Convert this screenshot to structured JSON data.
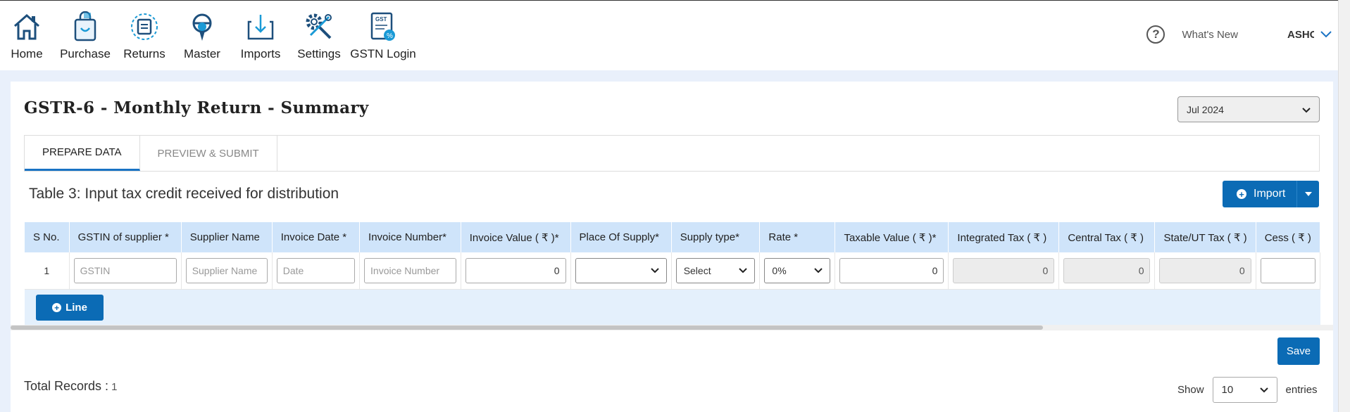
{
  "nav": {
    "items": [
      {
        "label": "Home",
        "icon": "home-icon"
      },
      {
        "label": "Purchase",
        "icon": "purchase-bag-icon"
      },
      {
        "label": "Returns",
        "icon": "returns-icon"
      },
      {
        "label": "Master",
        "icon": "master-icon"
      },
      {
        "label": "Imports",
        "icon": "imports-download-icon"
      },
      {
        "label": "Settings",
        "icon": "settings-tools-icon"
      },
      {
        "label": "GSTN Login",
        "icon": "gstn-document-icon"
      }
    ],
    "gst_icon_text": "GST"
  },
  "header": {
    "help_icon": "?",
    "whats_new": "What's New",
    "user": "ASHOK"
  },
  "page": {
    "title": "GSTR-6 - Monthly Return - Summary",
    "month": "Jul 2024"
  },
  "tabs": [
    {
      "label": "PREPARE DATA",
      "active": true
    },
    {
      "label": "PREVIEW & SUBMIT",
      "active": false
    }
  ],
  "section": {
    "title": "Table 3: Input tax credit received for distribution",
    "import_label": "Import"
  },
  "table": {
    "headers": [
      "S No.",
      "GSTIN of supplier *",
      "Supplier Name",
      "Invoice Date *",
      "Invoice Number*",
      "Invoice Value ( ₹ )*",
      "Place Of Supply*",
      "Supply type*",
      "Rate *",
      "Taxable Value ( ₹ )*",
      "Integrated Tax ( ₹ )",
      "Central Tax ( ₹ )",
      "State/UT Tax ( ₹ )",
      "Cess ( ₹ )"
    ],
    "row": {
      "sno": "1",
      "gstin_placeholder": "GSTIN",
      "supplier_placeholder": "Supplier Name",
      "date_placeholder": "Date",
      "invoice_placeholder": "Invoice Number",
      "invoice_value": "0",
      "place_of_supply": "",
      "supply_type": "Select",
      "rate": "0%",
      "taxable_value": "0",
      "integrated_tax": "0",
      "central_tax": "0",
      "state_tax": "0"
    },
    "line_label": "Line"
  },
  "footer": {
    "save_label": "Save",
    "total_label": "Total Records :",
    "total_count": "1",
    "show_label": "Show",
    "entries_value": "10",
    "entries_label": "entries"
  },
  "colors": {
    "primary": "#0b6bb5",
    "header_bg": "#cfe4fa",
    "page_bg": "#e9f0fb"
  }
}
